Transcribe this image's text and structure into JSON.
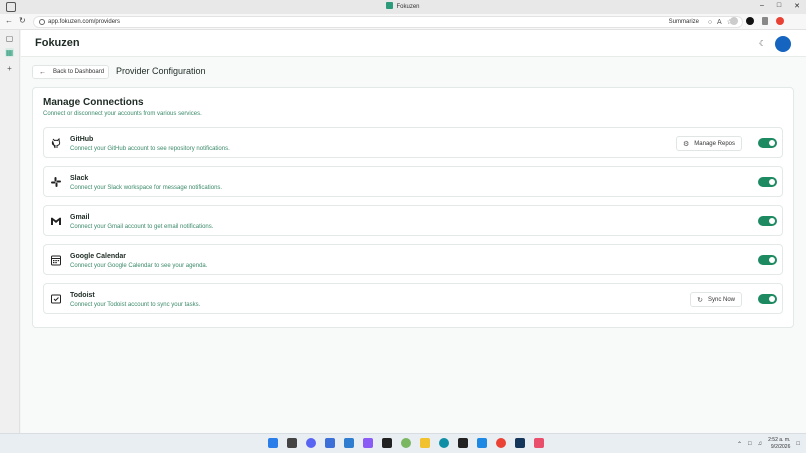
{
  "window": {
    "title": "Fokuzen",
    "url": "app.fokuzen.com/providers",
    "summarize_label": "Summarize"
  },
  "app": {
    "brand": "Fokuzen"
  },
  "nav": {
    "back_label": "Back to Dashboard",
    "page_title": "Provider Configuration"
  },
  "connections": {
    "title": "Manage Connections",
    "subtitle": "Connect or disconnect your accounts from various services.",
    "items": [
      {
        "name": "GitHub",
        "description": "Connect your GitHub account to see repository notifications.",
        "icon": "github-icon",
        "action": "Manage Repos",
        "action_icon": "gear-icon",
        "enabled": true
      },
      {
        "name": "Slack",
        "description": "Connect your Slack workspace for message notifications.",
        "icon": "slack-icon",
        "enabled": true
      },
      {
        "name": "Gmail",
        "description": "Connect your Gmail account to get email notifications.",
        "icon": "gmail-icon",
        "enabled": true
      },
      {
        "name": "Google Calendar",
        "description": "Connect your Google Calendar to see your agenda.",
        "icon": "calendar-icon",
        "enabled": true
      },
      {
        "name": "Todoist",
        "description": "Connect your Todoist account to sync your tasks.",
        "icon": "todoist-icon",
        "action": "Sync Now",
        "action_icon": "refresh-icon",
        "enabled": true
      }
    ]
  },
  "taskbar": {
    "time": "2:52 a. m.",
    "date": "9/2/2026"
  },
  "colors": {
    "accent": "#1e8a62",
    "description_text": "#3b8a6a",
    "avatar": "#1565c0"
  }
}
